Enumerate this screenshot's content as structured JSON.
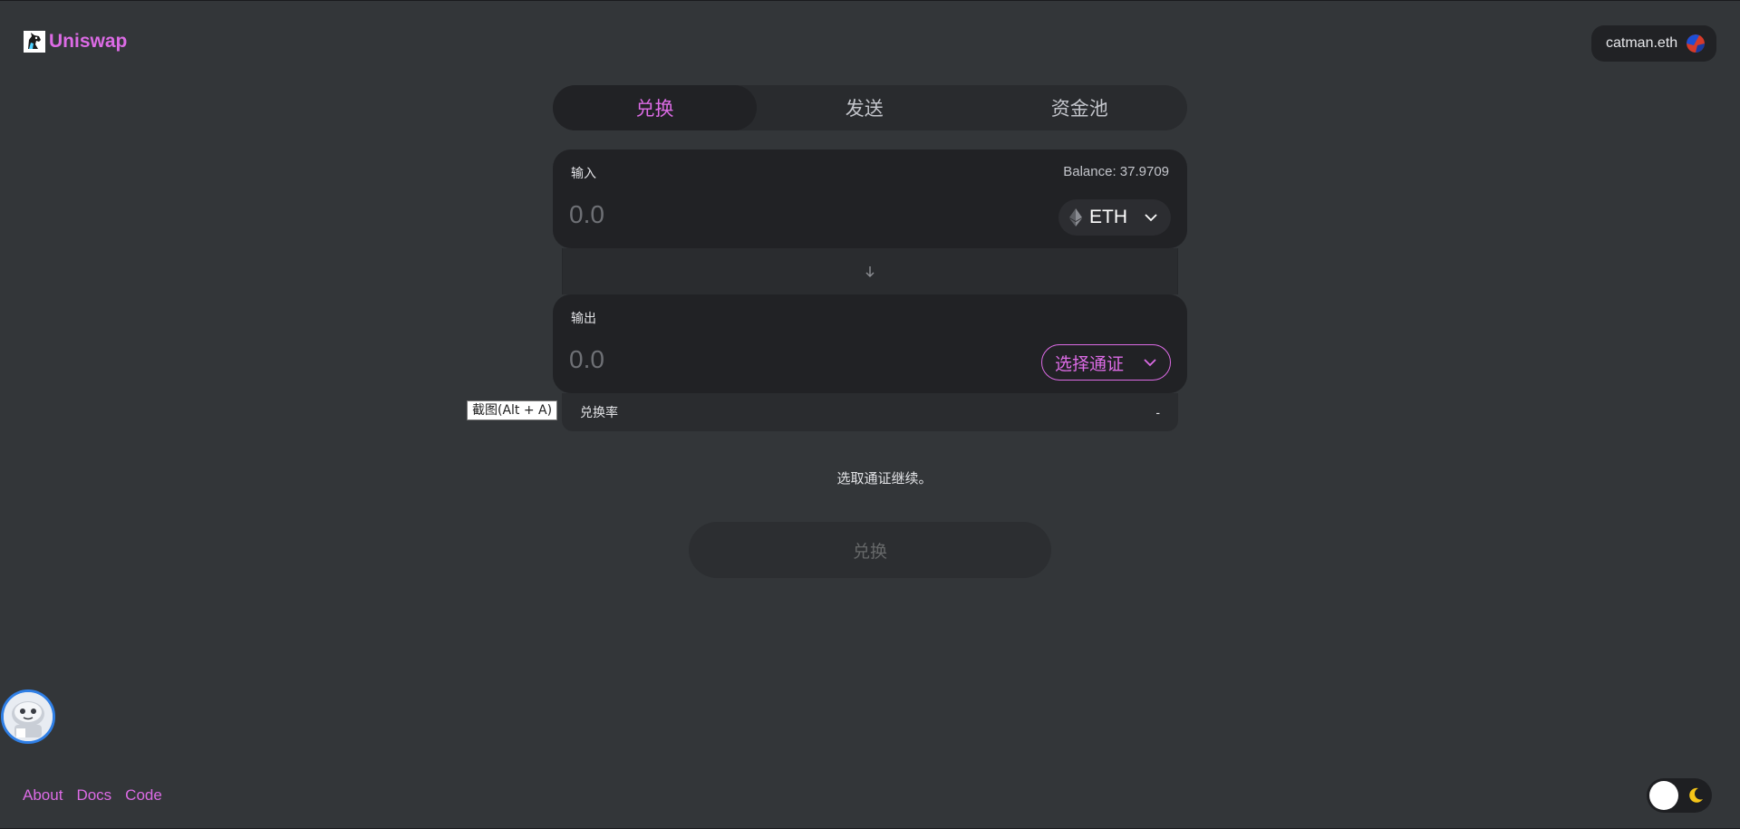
{
  "header": {
    "logo_text": "Uniswap",
    "account_name": "catman.eth"
  },
  "tabs": [
    {
      "label": "兑换",
      "active": true
    },
    {
      "label": "发送",
      "active": false
    },
    {
      "label": "资金池",
      "active": false
    }
  ],
  "input_panel": {
    "label": "输入",
    "balance": "Balance: 37.9709",
    "amount_placeholder": "0.0",
    "token": "ETH"
  },
  "output_panel": {
    "label": "输出",
    "amount_placeholder": "0.0",
    "token_select_label": "选择通证"
  },
  "rate": {
    "label": "兑换率",
    "value": "-"
  },
  "tooltip": "截图(Alt + A)",
  "hint": "选取通证继续。",
  "swap_button_label": "兑换",
  "footer": {
    "links": [
      "About",
      "Docs",
      "Code"
    ]
  },
  "colors": {
    "background": "#333639",
    "panel": "#212225",
    "accent": "#dc6be5",
    "avatar_ring": "#2f7fe6"
  },
  "theme": "dark"
}
